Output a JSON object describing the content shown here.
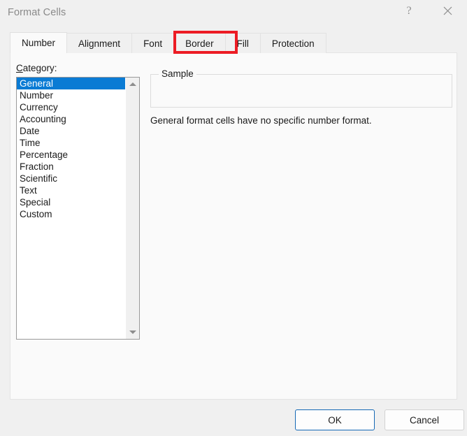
{
  "window": {
    "title": "Format Cells",
    "help_icon": "question-mark-icon",
    "close_icon": "close-icon"
  },
  "tabs": [
    {
      "label": "Number",
      "active": true
    },
    {
      "label": "Alignment",
      "active": false
    },
    {
      "label": "Font",
      "active": false
    },
    {
      "label": "Border",
      "active": false,
      "highlighted": true
    },
    {
      "label": "Fill",
      "active": false
    },
    {
      "label": "Protection",
      "active": false
    }
  ],
  "highlight": {
    "target": "Border",
    "color": "#ec1c24"
  },
  "number_tab": {
    "category_label_accel": "C",
    "category_label_rest": "ategory:",
    "categories": [
      "General",
      "Number",
      "Currency",
      "Accounting",
      "Date",
      "Time",
      "Percentage",
      "Fraction",
      "Scientific",
      "Text",
      "Special",
      "Custom"
    ],
    "selected_category": "General",
    "selection_color": "#0a7bd4",
    "scrollbar": {
      "up_icon": "scroll-up-arrow-icon",
      "down_icon": "scroll-down-arrow-icon"
    },
    "sample": {
      "legend": "Sample",
      "value": ""
    },
    "description": "General format cells have no specific number format."
  },
  "footer": {
    "ok_label": "OK",
    "cancel_label": "Cancel",
    "default_button_border": "#1569b5"
  }
}
